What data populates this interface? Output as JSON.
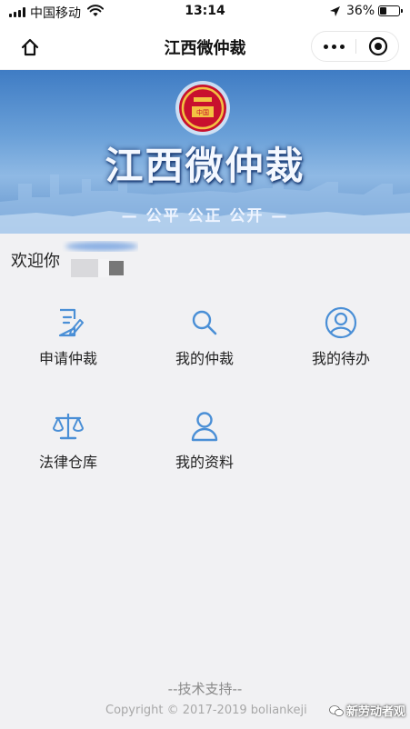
{
  "status_bar": {
    "carrier": "中国移动",
    "time": "13:14",
    "battery": "36%",
    "battery_level": 0.36
  },
  "nav": {
    "title": "江西微仲裁"
  },
  "banner": {
    "title": "江西微仲裁",
    "slogan": "— 公平 公正 公开 —",
    "emblem_text": "中国"
  },
  "welcome": {
    "text": "欢迎你"
  },
  "menu": [
    {
      "label": "申请仲裁",
      "icon": "document-edit-icon"
    },
    {
      "label": "我的仲裁",
      "icon": "search-icon"
    },
    {
      "label": "我的待办",
      "icon": "user-circle-icon"
    },
    {
      "label": "法律仓库",
      "icon": "scales-icon"
    },
    {
      "label": "我的资料",
      "icon": "user-icon"
    }
  ],
  "footer": {
    "title": "--技术支持--",
    "copyright": "Copyright © 2017-2019 boliankeji"
  },
  "watermark": {
    "text": "新劳动者观"
  },
  "colors": {
    "icon_blue": "#4a8fd6",
    "banner_blue": "#3f7cc4",
    "background": "#f1f1f3"
  }
}
